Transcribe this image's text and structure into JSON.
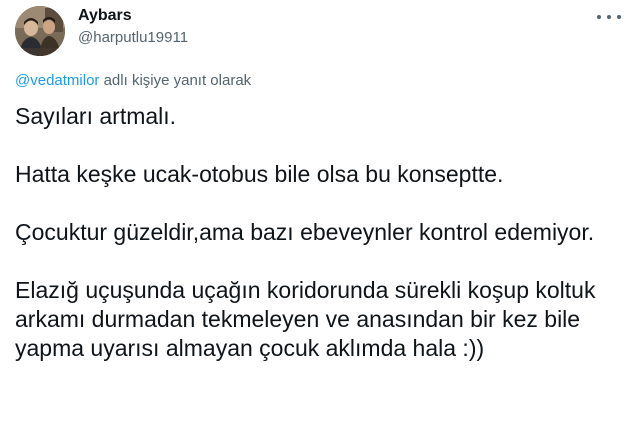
{
  "author": {
    "display_name": "Aybars",
    "handle": "@harputlu19911"
  },
  "reply_context": {
    "mention": "@vedatmilor",
    "suffix": " adlı kişiye yanıt olarak"
  },
  "tweet": {
    "paragraphs": [
      "Sayıları artmalı.",
      "Hatta keşke ucak-otobus bile olsa bu konseptte.",
      "Çocuktur güzeldir,ama bazı ebeveynler kontrol edemiyor.",
      "Elazığ uçuşunda uçağın koridorunda sürekli koşup koltuk arkamı durmadan tekmeleyen ve anasından bir kez bile yapma uyarısı almayan çocuk aklımda hala :))"
    ]
  },
  "icons": {
    "avatar": "profile-photo",
    "more": "more-options-icon"
  },
  "colors": {
    "text": "#0f1419",
    "secondary": "#536471",
    "link": "#1d9bf0",
    "background": "#ffffff"
  }
}
